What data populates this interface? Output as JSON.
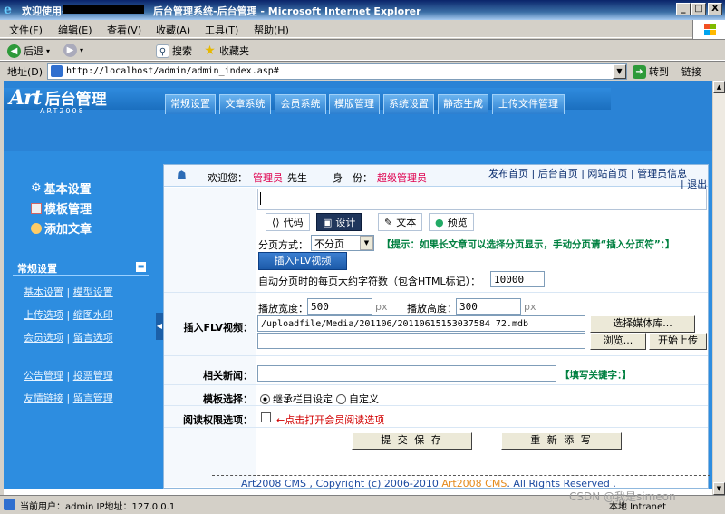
{
  "window": {
    "title_prefix": "欢迎使用—",
    "title_suffix": "后台管理系统-后台管理 - Microsoft Internet Explorer",
    "controls": [
      "_",
      "□",
      "X"
    ]
  },
  "menu": [
    "文件(F)",
    "编辑(E)",
    "查看(V)",
    "收藏(A)",
    "工具(T)",
    "帮助(H)"
  ],
  "toolbar": {
    "back": "后退",
    "search": "搜索",
    "favorites": "收藏夹"
  },
  "address": {
    "label": "地址(D)",
    "url": "http://localhost/admin/admin_index.asp#",
    "go": "转到",
    "links": "链接"
  },
  "logo": {
    "main": "后台管理",
    "sub": "ART2008"
  },
  "nav_tabs": [
    "常规设置",
    "文章系统",
    "会员系统",
    "模版管理",
    "系统设置",
    "静态生成",
    "上传文件管理"
  ],
  "sidebar": {
    "top_links": [
      "基本设置",
      "模板管理",
      "添加文章"
    ],
    "section_title": "常规设置",
    "sub_links": [
      [
        "基本设置",
        "模型设置"
      ],
      [
        "上传选项",
        "缩图水印"
      ],
      [
        "会员选项",
        "留言选项"
      ],
      [
        "公告管理",
        "投票管理"
      ],
      [
        "友情链接",
        "留言管理"
      ]
    ]
  },
  "userbar": {
    "welcome_label": "欢迎您：",
    "user_name": "管理员",
    "honorific": "先生",
    "role_label": "身　份：",
    "role": "超级管理员",
    "links": [
      "发布首页",
      "后台首页",
      "网站首页",
      "管理员信息",
      "退出"
    ]
  },
  "editor_tabs": [
    "代码",
    "设计",
    "文本",
    "预览"
  ],
  "pagination": {
    "label": "分页方式：",
    "value": "不分页",
    "hint": "【提示：如果长文章可以选择分页显示，手动分页请“插入分页符”：】",
    "insert_flv_button": "插入FLV视频",
    "auto_label": "自动分页时的每页大约字符数（包含HTML标记）：",
    "auto_value": "10000"
  },
  "flv": {
    "label": "插入FLV视频：",
    "width_label": "播放宽度：",
    "width_value": "500",
    "height_label": "播放高度：",
    "height_value": "300",
    "unit": "px",
    "path_value": "/uploadfile/Media/201106/20110615153037584 72.mdb",
    "select_button": "选择媒体库...",
    "browse_button": "浏览...",
    "upload_button": "开始上传"
  },
  "related": {
    "label": "相关新闻：",
    "hint": "【填写关键字：】"
  },
  "template": {
    "label": "模板选择：",
    "option1": "继承栏目设定",
    "option2": "自定义"
  },
  "permission": {
    "label": "阅读权限选项：",
    "hint": "←点击打开会员阅读选项"
  },
  "actions": {
    "submit": "提 交 保 存",
    "reset": "重 新 添 写"
  },
  "footer": {
    "copy_a": "Art2008 CMS , Copyright (c) 2006-2010 ",
    "copy_b": "Art2008 CMS",
    "copy_c": ". All Rights Reserved ."
  },
  "status": {
    "user": "当前用户：admin  IP地址：127.0.0.1",
    "zone": "本地 Intranet",
    "watermark": "CSDN @我是simeon"
  }
}
